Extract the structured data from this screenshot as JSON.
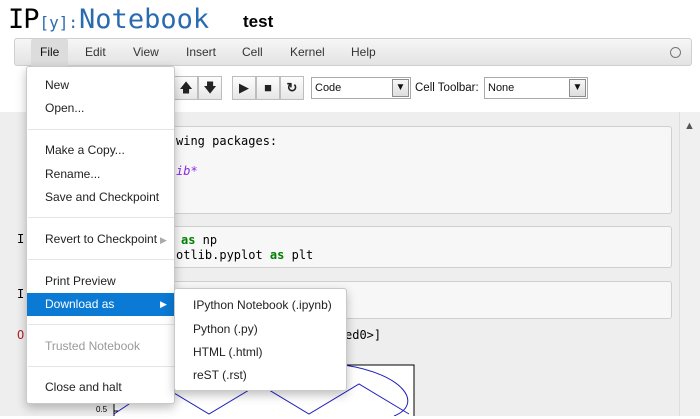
{
  "header": {
    "logo_ip": "IP",
    "logo_y": "[y]:",
    "logo_notebook": "Notebook",
    "notebook_name": "test"
  },
  "menubar": {
    "items": [
      "File",
      "Edit",
      "View",
      "Insert",
      "Cell",
      "Kernel",
      "Help"
    ]
  },
  "toolbar": {
    "move_up_icon": "arrow-up",
    "move_down_icon": "arrow-down",
    "run_icon": "play",
    "stop_icon": "stop",
    "restart_icon": "restart",
    "cell_type_value": "Code",
    "cell_toolbar_label": "Cell Toolbar:",
    "cell_toolbar_value": "None"
  },
  "file_menu": {
    "new": "New",
    "open": "Open...",
    "make_copy": "Make a Copy...",
    "rename": "Rename...",
    "save_checkpoint": "Save and Checkpoint",
    "revert": "Revert to Checkpoint",
    "print_preview": "Print Preview",
    "download_as": "Download as",
    "trusted": "Trusted Notebook",
    "close_halt": "Close and halt"
  },
  "download_submenu": {
    "items": [
      "IPython Notebook (.ipynb)",
      "Python (.py)",
      "HTML (.html)",
      "reST (.rst)"
    ]
  },
  "cells": {
    "md_line1": "wing packages:",
    "md_line2": "ib*",
    "code1_kw1": "as",
    "code1_rest1": " np",
    "code1_line2a": "otlib.pyplot ",
    "code1_kw2": "as",
    "code1_line2b": " plt",
    "out_frag": "ed0>]",
    "prompt_in1": "I",
    "prompt_in2": "I",
    "prompt_out": "O",
    "axis_tick": "0.5"
  },
  "colors": {
    "accent": "#0a7ad4",
    "logo_blue": "#2a6bb0",
    "keyword": "#008000",
    "plot_line": "#1f1fbf"
  }
}
